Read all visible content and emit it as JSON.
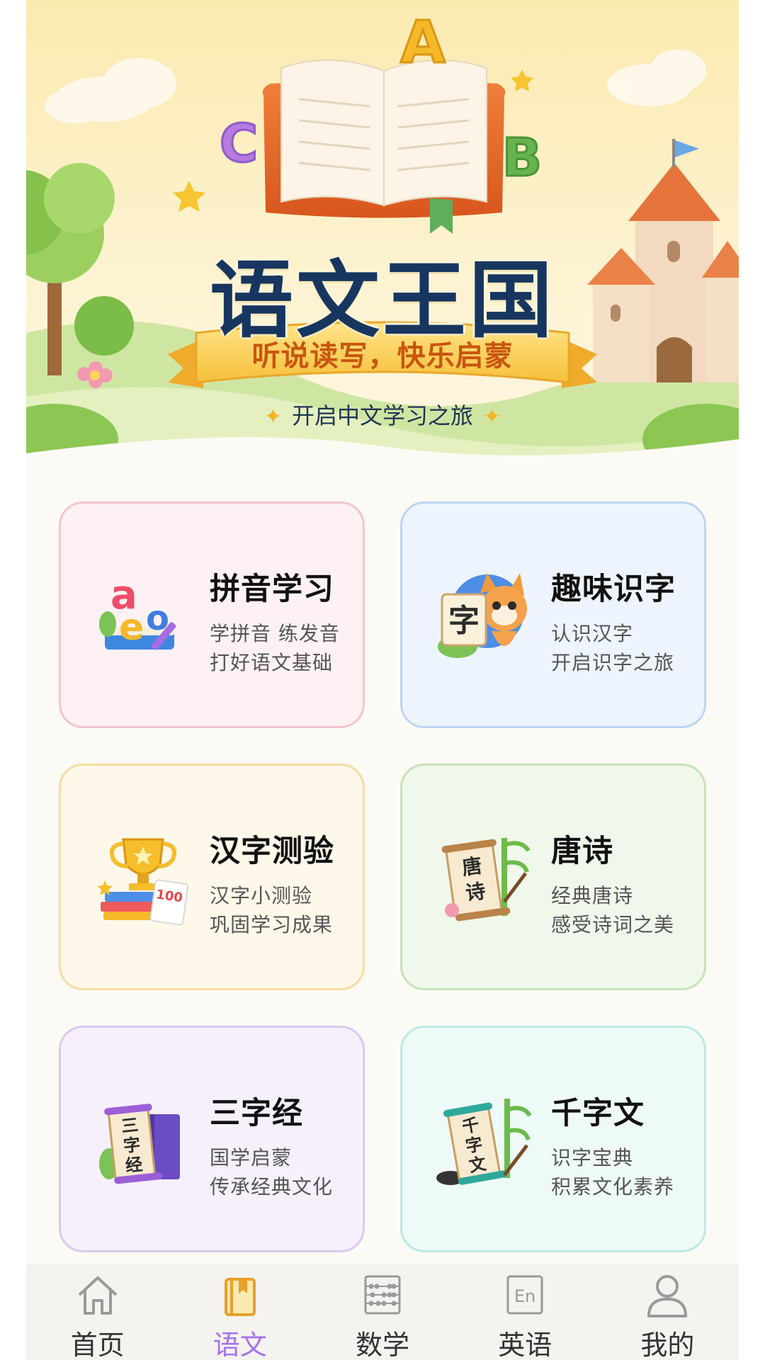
{
  "hero": {
    "title": "语文王国",
    "ribbon": "听说读写，快乐启蒙",
    "subtitle": "开启中文学习之旅",
    "letters": [
      "A",
      "B",
      "C"
    ]
  },
  "cards": [
    {
      "title": "拼音学习",
      "line1": "学拼音 练发音",
      "line2": "打好语文基础",
      "icon": "pinyin-letters-icon",
      "letters": [
        "a",
        "e",
        "o"
      ]
    },
    {
      "title": "趣味识字",
      "line1": "认识汉字",
      "line2": "开启识字之旅",
      "icon": "cat-character-icon",
      "char": "字"
    },
    {
      "title": "汉字测验",
      "line1": "汉字小测验",
      "line2": "巩固学习成果",
      "icon": "trophy-icon",
      "score": "100"
    },
    {
      "title": "唐诗",
      "line1": "经典唐诗",
      "line2": "感受诗词之美",
      "icon": "tang-scroll-icon",
      "chars": [
        "唐",
        "诗"
      ]
    },
    {
      "title": "三字经",
      "line1": "国学启蒙",
      "line2": "传承经典文化",
      "icon": "sanzijing-scroll-icon",
      "chars": [
        "三",
        "字",
        "经"
      ]
    },
    {
      "title": "千字文",
      "line1": "识字宝典",
      "line2": "积累文化素养",
      "icon": "qianziwen-scroll-icon",
      "chars": [
        "千",
        "字",
        "文"
      ]
    }
  ],
  "nav": {
    "items": [
      {
        "label": "首页",
        "icon": "home-icon"
      },
      {
        "label": "语文",
        "icon": "book-icon",
        "active": true
      },
      {
        "label": "数学",
        "icon": "abacus-icon"
      },
      {
        "label": "英语",
        "icon": "english-icon",
        "icon_text": "En"
      },
      {
        "label": "我的",
        "icon": "profile-icon"
      }
    ]
  },
  "colors": {
    "title": "#17365f",
    "ribbon_text": "#c8560e",
    "nav_active": "#a872e8",
    "nav_inactive": "#9a9a9a"
  }
}
